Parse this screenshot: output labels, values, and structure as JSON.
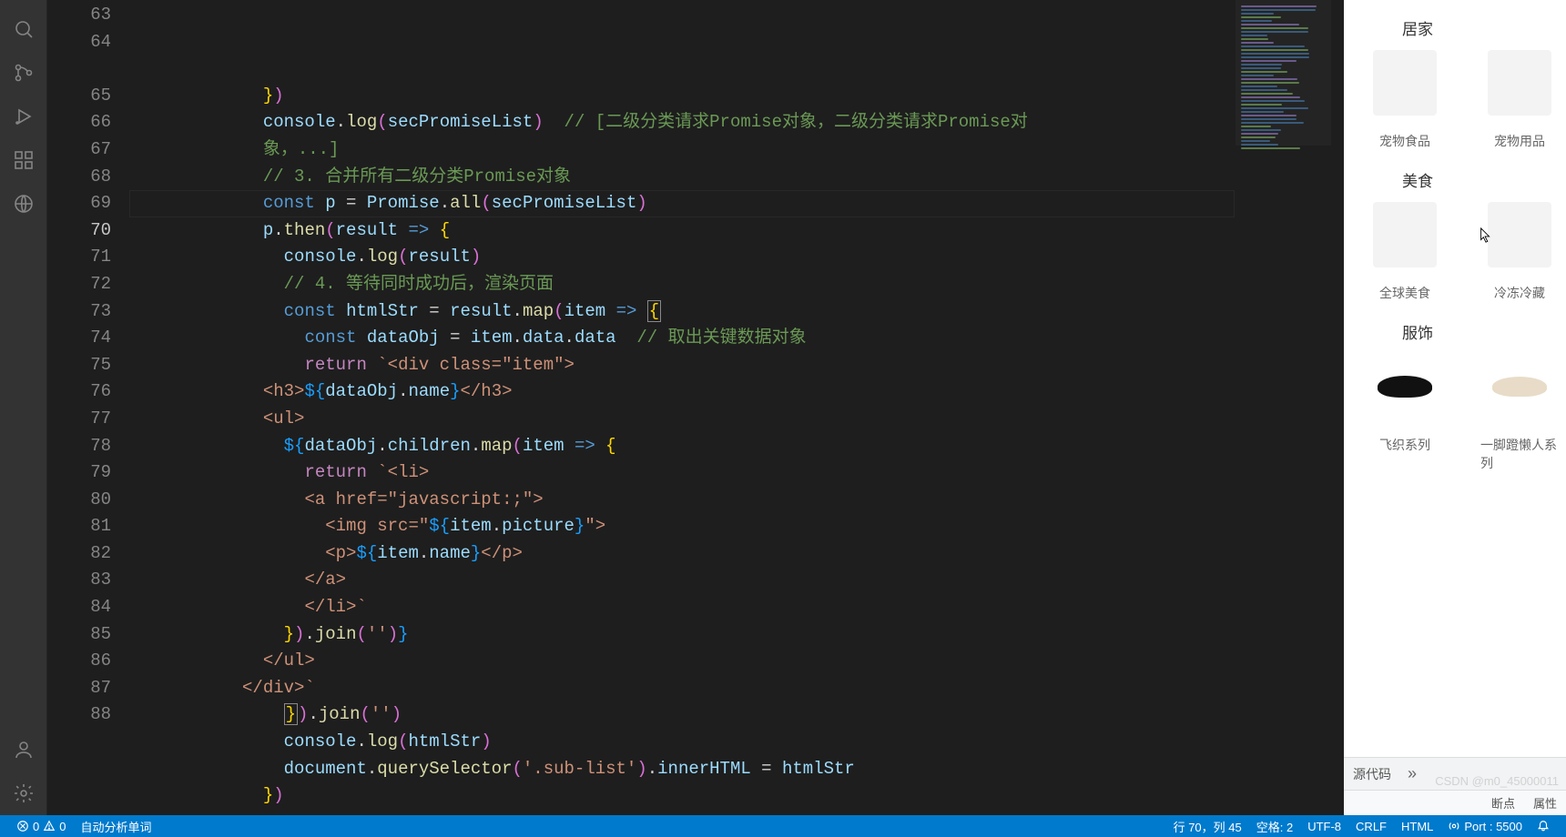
{
  "activity_icons": [
    "search",
    "source-control",
    "run",
    "extensions",
    "remote-explorer"
  ],
  "activity_bottom_icons": [
    "account",
    "gear"
  ],
  "gutter": {
    "start": 63,
    "end": 88,
    "active": 70
  },
  "code_lines": [
    {
      "n": 63,
      "ind": 3,
      "tokens": [
        [
          "by",
          "}"
        ],
        [
          "bp",
          ")"
        ]
      ]
    },
    {
      "n": 64,
      "ind": 3,
      "tokens": [
        [
          "v",
          "console"
        ],
        [
          "p",
          "."
        ],
        [
          "fn",
          "log"
        ],
        [
          "bp",
          "("
        ],
        [
          "v",
          "secPromiseList"
        ],
        [
          "bp",
          ")"
        ],
        [
          "p",
          "  "
        ],
        [
          "c",
          "// [二级分类请求Promise对象，二级分类请求Promise对"
        ]
      ]
    },
    {
      "n": 64.1,
      "cont": true,
      "ind": 3,
      "tokens": [
        [
          "c",
          "象，...]"
        ]
      ]
    },
    {
      "n": 65,
      "ind": 3,
      "tokens": [
        [
          "c",
          "// 3. 合并所有二级分类Promise对象"
        ]
      ]
    },
    {
      "n": 66,
      "ind": 3,
      "tokens": [
        [
          "k",
          "const"
        ],
        [
          "p",
          " "
        ],
        [
          "v",
          "p"
        ],
        [
          "p",
          " = "
        ],
        [
          "v",
          "Promise"
        ],
        [
          "p",
          "."
        ],
        [
          "fn",
          "all"
        ],
        [
          "bp",
          "("
        ],
        [
          "v",
          "secPromiseList"
        ],
        [
          "bp",
          ")"
        ]
      ]
    },
    {
      "n": 67,
      "ind": 3,
      "tokens": [
        [
          "v",
          "p"
        ],
        [
          "p",
          "."
        ],
        [
          "fn",
          "then"
        ],
        [
          "bp",
          "("
        ],
        [
          "v",
          "result"
        ],
        [
          "p",
          " "
        ],
        [
          "k",
          "=>"
        ],
        [
          "p",
          " "
        ],
        [
          "by",
          "{"
        ]
      ]
    },
    {
      "n": 68,
      "ind": 4,
      "tokens": [
        [
          "v",
          "console"
        ],
        [
          "p",
          "."
        ],
        [
          "fn",
          "log"
        ],
        [
          "bp",
          "("
        ],
        [
          "v",
          "result"
        ],
        [
          "bp",
          ")"
        ]
      ]
    },
    {
      "n": 69,
      "ind": 4,
      "tokens": [
        [
          "c",
          "// 4. 等待同时成功后，渲染页面"
        ]
      ]
    },
    {
      "n": 70,
      "ind": 4,
      "tokens": [
        [
          "k",
          "const"
        ],
        [
          "p",
          " "
        ],
        [
          "v",
          "htmlStr"
        ],
        [
          "p",
          " = "
        ],
        [
          "v",
          "result"
        ],
        [
          "p",
          "."
        ],
        [
          "fn",
          "map"
        ],
        [
          "bp",
          "("
        ],
        [
          "v",
          "item"
        ],
        [
          "p",
          " "
        ],
        [
          "k",
          "=>"
        ],
        [
          "p",
          " "
        ],
        [
          "by",
          "{",
          "box"
        ]
      ]
    },
    {
      "n": 71,
      "ind": 5,
      "tokens": [
        [
          "k",
          "const"
        ],
        [
          "p",
          " "
        ],
        [
          "v",
          "dataObj"
        ],
        [
          "p",
          " = "
        ],
        [
          "v",
          "item"
        ],
        [
          "p",
          "."
        ],
        [
          "v",
          "data"
        ],
        [
          "p",
          "."
        ],
        [
          "v",
          "data"
        ],
        [
          "p",
          "  "
        ],
        [
          "c",
          "// 取出关键数据对象"
        ]
      ]
    },
    {
      "n": 72,
      "ind": 5,
      "tokens": [
        [
          "kw",
          "return"
        ],
        [
          "p",
          " "
        ],
        [
          "s",
          "`<div class=\"item\">"
        ]
      ]
    },
    {
      "n": 73,
      "ind": 3,
      "tokens": [
        [
          "s",
          "<h3>"
        ],
        [
          "bb",
          "${"
        ],
        [
          "v",
          "dataObj"
        ],
        [
          "p",
          "."
        ],
        [
          "v",
          "name"
        ],
        [
          "bb",
          "}"
        ],
        [
          "s",
          "</h3>"
        ]
      ]
    },
    {
      "n": 74,
      "ind": 3,
      "tokens": [
        [
          "s",
          "<ul>"
        ]
      ]
    },
    {
      "n": 75,
      "ind": 4,
      "tokens": [
        [
          "bb",
          "${"
        ],
        [
          "v",
          "dataObj"
        ],
        [
          "p",
          "."
        ],
        [
          "v",
          "children"
        ],
        [
          "p",
          "."
        ],
        [
          "fn",
          "map"
        ],
        [
          "bp",
          "("
        ],
        [
          "v",
          "item"
        ],
        [
          "p",
          " "
        ],
        [
          "k",
          "=>"
        ],
        [
          "p",
          " "
        ],
        [
          "by",
          "{"
        ]
      ]
    },
    {
      "n": 76,
      "ind": 5,
      "tokens": [
        [
          "kw",
          "return"
        ],
        [
          "p",
          " "
        ],
        [
          "s",
          "`<li>"
        ]
      ]
    },
    {
      "n": 77,
      "ind": 5,
      "tokens": [
        [
          "s",
          "<a href=\"javascript:;\">"
        ]
      ]
    },
    {
      "n": 78,
      "ind": 6,
      "tokens": [
        [
          "s",
          "<img src=\""
        ],
        [
          "bb",
          "${"
        ],
        [
          "v",
          "item"
        ],
        [
          "p",
          "."
        ],
        [
          "v",
          "picture"
        ],
        [
          "bb",
          "}"
        ],
        [
          "s",
          "\">"
        ]
      ]
    },
    {
      "n": 79,
      "ind": 6,
      "tokens": [
        [
          "s",
          "<p>"
        ],
        [
          "bb",
          "${"
        ],
        [
          "v",
          "item"
        ],
        [
          "p",
          "."
        ],
        [
          "v",
          "name"
        ],
        [
          "bb",
          "}"
        ],
        [
          "s",
          "</p>"
        ]
      ]
    },
    {
      "n": 80,
      "ind": 5,
      "tokens": [
        [
          "s",
          "</a>"
        ]
      ]
    },
    {
      "n": 81,
      "ind": 5,
      "tokens": [
        [
          "s",
          "</li>`"
        ]
      ]
    },
    {
      "n": 82,
      "ind": 4,
      "tokens": [
        [
          "by",
          "}"
        ],
        [
          "bp",
          ")"
        ],
        [
          "p",
          "."
        ],
        [
          "fn",
          "join"
        ],
        [
          "bp",
          "("
        ],
        [
          "s",
          "''"
        ],
        [
          "bp",
          ")"
        ],
        [
          "bb",
          "}"
        ]
      ]
    },
    {
      "n": 83,
      "ind": 3,
      "tokens": [
        [
          "s",
          "</ul>"
        ]
      ]
    },
    {
      "n": 84,
      "ind": 2,
      "tokens": [
        [
          "s",
          "</div>`"
        ]
      ]
    },
    {
      "n": 85,
      "ind": 4,
      "tokens": [
        [
          "by",
          "}",
          "box"
        ],
        [
          "bp",
          ")"
        ],
        [
          "p",
          "."
        ],
        [
          "fn",
          "join"
        ],
        [
          "bp",
          "("
        ],
        [
          "s",
          "''"
        ],
        [
          "bp",
          ")"
        ]
      ]
    },
    {
      "n": 86,
      "ind": 4,
      "tokens": [
        [
          "v",
          "console"
        ],
        [
          "p",
          "."
        ],
        [
          "fn",
          "log"
        ],
        [
          "bp",
          "("
        ],
        [
          "v",
          "htmlStr"
        ],
        [
          "bp",
          ")"
        ]
      ]
    },
    {
      "n": 87,
      "ind": 4,
      "tokens": [
        [
          "v",
          "document"
        ],
        [
          "p",
          "."
        ],
        [
          "fn",
          "querySelector"
        ],
        [
          "bp",
          "("
        ],
        [
          "s",
          "'.sub-list'"
        ],
        [
          "bp",
          ")"
        ],
        [
          "p",
          "."
        ],
        [
          "v",
          "innerHTML"
        ],
        [
          "p",
          " = "
        ],
        [
          "v",
          "htmlStr"
        ]
      ]
    },
    {
      "n": 88,
      "ind": 3,
      "tokens": [
        [
          "by",
          "}"
        ],
        [
          "bp",
          ")"
        ]
      ]
    }
  ],
  "preview": {
    "sections": [
      {
        "title": "居家",
        "items": [
          "宠物食品",
          "宠物用品"
        ]
      },
      {
        "title": "美食",
        "items": [
          "全球美食",
          "冷冻冷藏"
        ]
      },
      {
        "title": "服饰",
        "items": [
          "飞织系列",
          "一脚蹬懒人系列"
        ]
      }
    ],
    "devtools_tabs": [
      "源代码"
    ],
    "devtools_sub": [
      "断点",
      "属性"
    ]
  },
  "status": {
    "errors": "0",
    "warnings": "0",
    "auto": "自动分析单词",
    "pos": "行 70，列 45",
    "spaces": "空格: 2",
    "encoding": "UTF-8",
    "eol": "CRLF",
    "lang": "HTML",
    "port": "Port : 5500"
  },
  "watermark": "CSDN @m0_45000011"
}
